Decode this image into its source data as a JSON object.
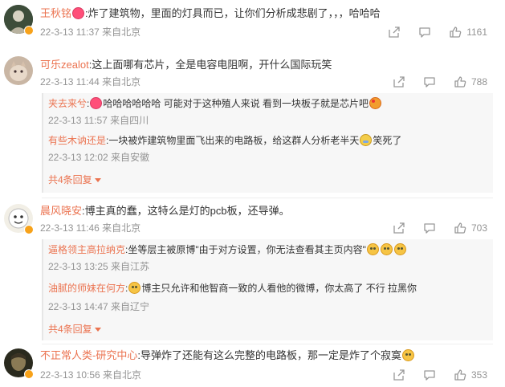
{
  "comments": [
    {
      "user": "王秋铭",
      "text_after": ":炸了建筑物，里面的灯具而已，让你们分析成悲剧了，，，哈哈哈",
      "meta": "22-3-13 11:37 来自北京",
      "likes": "1161",
      "verified": true,
      "avatar_icon": "user-avatar",
      "emoji_prefix": "heart-emoji"
    },
    {
      "user": "可乐zealot",
      "text_after": ":这上面哪有芯片，全是电容电阻啊，开什么国际玩笑",
      "meta": "22-3-13 11:44 来自北京",
      "likes": "788",
      "replies": [
        {
          "user": "夹去来兮",
          "text_before": "",
          "text_after": "哈哈哈哈哈哈 可能对于这种殖人来说 看到一块板子就是芯片吧",
          "meta": "22-3-13 11:57 来自四川"
        },
        {
          "user": "有些木讷还是",
          "text_after": ":一块被炸建筑物里面飞出来的电路板，给这群人分析老半天",
          "text_tail": "笑死了",
          "meta": "22-3-13 12:02 来自安徽"
        }
      ],
      "more_label": "共4条回复"
    },
    {
      "user": "晨风晓安",
      "text_after": ":博主真的蠢，这特么是灯的pcb板，还导弹。",
      "meta": "22-3-13 11:46 来自北京",
      "likes": "703",
      "verified": true,
      "replies": [
        {
          "user": "逼格领主高拉纳克",
          "text_after": ":坐等层主被原博\"由于对方设置，你无法查看其主页内容\"",
          "meta": "22-3-13 13:25 来自江苏"
        },
        {
          "user": "油腻的师妹在何方",
          "text_after": "博主只允许和他智商一致的人看他的微博，你太高了 不行  拉黑你",
          "meta": "22-3-13 14:47 来自辽宁"
        }
      ],
      "more_label": "共4条回复"
    },
    {
      "user": "不正常人类-研究中心",
      "text_after": ":导弹炸了还能有这么完整的电路板，那一定是炸了个寂寞",
      "meta": "22-3-13 10:56 来自北京",
      "likes": "353",
      "verified": true
    }
  ],
  "colors": {
    "username": "#eb7350",
    "meta": "#939393",
    "reply_bg": "#f7f7f7"
  }
}
